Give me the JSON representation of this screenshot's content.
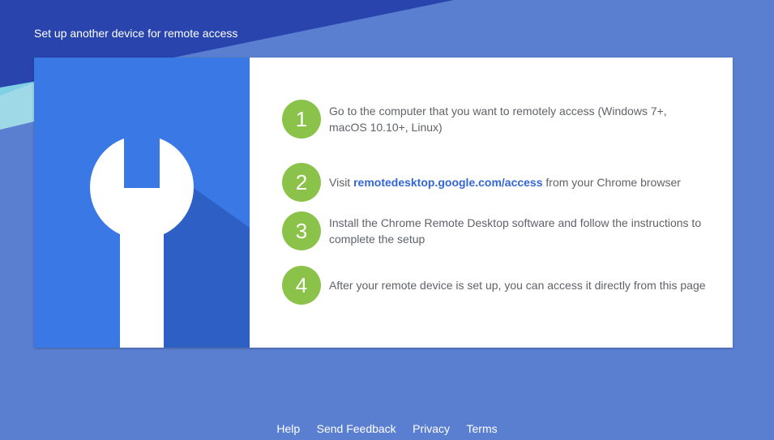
{
  "page_title": "Set up another device for remote access",
  "colors": {
    "background": "#5b7fd0",
    "background_dark": "#2945ad",
    "illustration_blue": "#3a78e6",
    "illustration_shadow": "#2e5fc4",
    "step_circle": "#8bc34a",
    "link": "#3367d6",
    "text": "#5f6368"
  },
  "illustration": {
    "icon": "wrench-icon"
  },
  "steps": [
    {
      "number": "1",
      "text": "Go to the computer that you want to remotely access (Windows 7+, macOS 10.10+, Linux)"
    },
    {
      "number": "2",
      "text_before": "Visit ",
      "link": "remotedesktop.google.com/access",
      "text_after": " from your Chrome browser"
    },
    {
      "number": "3",
      "text": "Install the Chrome Remote Desktop software and follow the instructions to complete the setup"
    },
    {
      "number": "4",
      "text": "After your remote device is set up, you can access it directly from this page"
    }
  ],
  "footer": {
    "links": [
      "Help",
      "Send Feedback",
      "Privacy",
      "Terms"
    ]
  }
}
